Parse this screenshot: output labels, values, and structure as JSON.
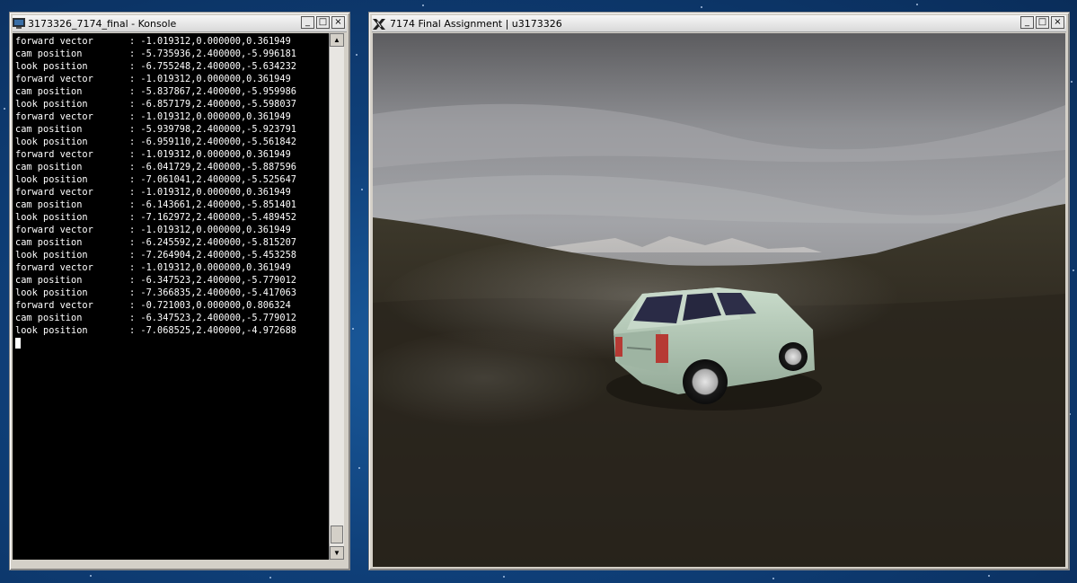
{
  "colors": {
    "desktop": "#0f3f78",
    "terminal_bg": "#000000",
    "terminal_fg": "#ffffff",
    "car_body": "#b9cfbe"
  },
  "konsole": {
    "title": "3173326_7174_final - Konsole",
    "icon": "terminal-icon",
    "buttons": {
      "minimize": "_",
      "maximize": "□",
      "close": "×"
    },
    "lines": [
      {
        "label": "forward vector",
        "value": ": -1.019312,0.000000,0.361949"
      },
      {
        "label": "cam position",
        "value": ": -5.735936,2.400000,-5.996181"
      },
      {
        "label": "look position",
        "value": ": -6.755248,2.400000,-5.634232"
      },
      {
        "label": "forward vector",
        "value": ": -1.019312,0.000000,0.361949"
      },
      {
        "label": "cam position",
        "value": ": -5.837867,2.400000,-5.959986"
      },
      {
        "label": "look position",
        "value": ": -6.857179,2.400000,-5.598037"
      },
      {
        "label": "forward vector",
        "value": ": -1.019312,0.000000,0.361949"
      },
      {
        "label": "cam position",
        "value": ": -5.939798,2.400000,-5.923791"
      },
      {
        "label": "look position",
        "value": ": -6.959110,2.400000,-5.561842"
      },
      {
        "label": "forward vector",
        "value": ": -1.019312,0.000000,0.361949"
      },
      {
        "label": "cam position",
        "value": ": -6.041729,2.400000,-5.887596"
      },
      {
        "label": "look position",
        "value": ": -7.061041,2.400000,-5.525647"
      },
      {
        "label": "forward vector",
        "value": ": -1.019312,0.000000,0.361949"
      },
      {
        "label": "cam position",
        "value": ": -6.143661,2.400000,-5.851401"
      },
      {
        "label": "look position",
        "value": ": -7.162972,2.400000,-5.489452"
      },
      {
        "label": "forward vector",
        "value": ": -1.019312,0.000000,0.361949"
      },
      {
        "label": "cam position",
        "value": ": -6.245592,2.400000,-5.815207"
      },
      {
        "label": "look position",
        "value": ": -7.264904,2.400000,-5.453258"
      },
      {
        "label": "forward vector",
        "value": ": -1.019312,0.000000,0.361949"
      },
      {
        "label": "cam position",
        "value": ": -6.347523,2.400000,-5.779012"
      },
      {
        "label": "look position",
        "value": ": -7.366835,2.400000,-5.417063"
      },
      {
        "label": "forward vector",
        "value": ": -0.721003,0.000000,0.806324"
      },
      {
        "label": "cam position",
        "value": ": -6.347523,2.400000,-5.779012"
      },
      {
        "label": "look position",
        "value": ": -7.068525,2.400000,-4.972688"
      }
    ]
  },
  "glwindow": {
    "title": "7174 Final Assignment | u3173326",
    "icon": "x-logo-icon",
    "buttons": {
      "minimize": "_",
      "maximize": "□",
      "close": "×"
    }
  }
}
